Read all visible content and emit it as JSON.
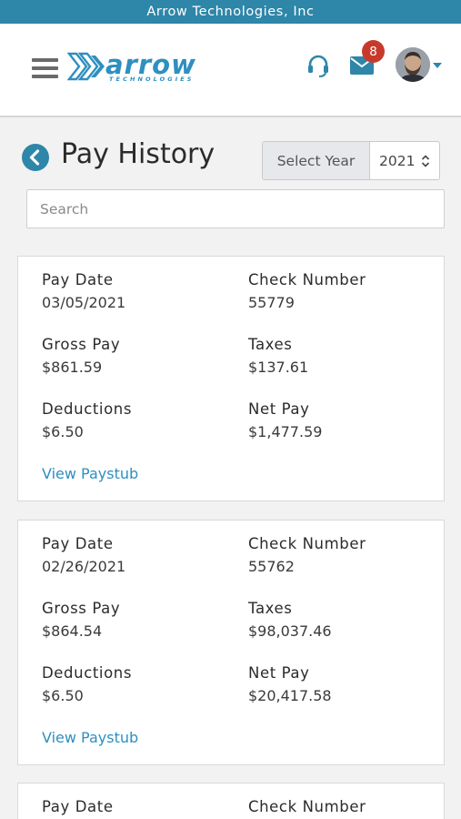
{
  "company_bar": "Arrow Technologies, Inc",
  "brand": {
    "name": "arrow",
    "tagline": "TECHNOLOGIES"
  },
  "header": {
    "notification_count": "8"
  },
  "page": {
    "title": "Pay History",
    "year_select_label": "Select Year",
    "year_value": "2021",
    "search_placeholder": "Search"
  },
  "labels": {
    "pay_date": "Pay Date",
    "check_number": "Check Number",
    "gross_pay": "Gross Pay",
    "taxes": "Taxes",
    "deductions": "Deductions",
    "net_pay": "Net Pay",
    "view_paystub": "View Paystub"
  },
  "records": [
    {
      "pay_date": "03/05/2021",
      "check_number": "55779",
      "gross_pay": "$861.59",
      "taxes": "$137.61",
      "deductions": "$6.50",
      "net_pay": "$1,477.59"
    },
    {
      "pay_date": "02/26/2021",
      "check_number": "55762",
      "gross_pay": "$864.54",
      "taxes": "$98,037.46",
      "deductions": "$6.50",
      "net_pay": "$20,417.58"
    }
  ],
  "colors": {
    "accent": "#2e86a8",
    "link": "#2e8fc0",
    "badge": "#c73a2b"
  }
}
